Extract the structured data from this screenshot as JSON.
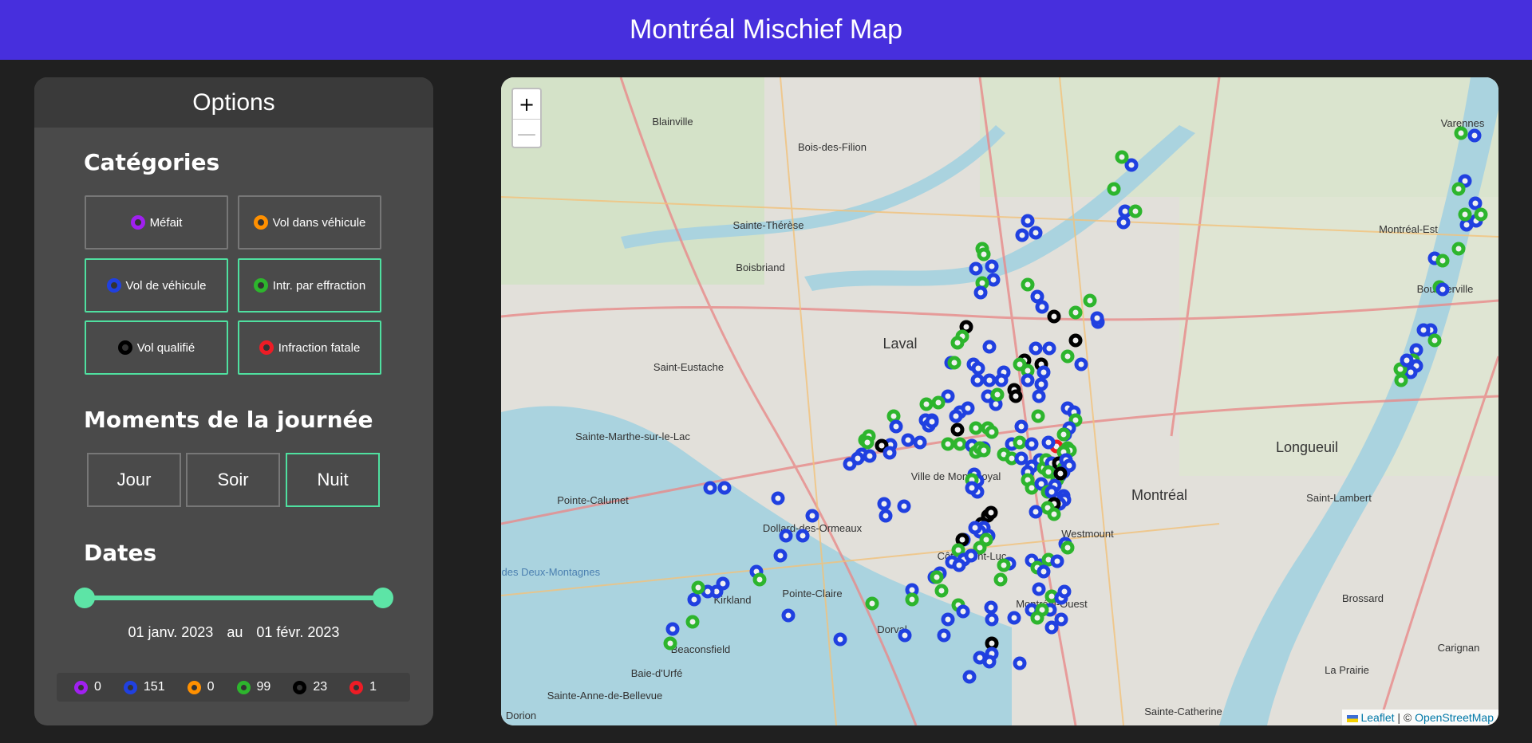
{
  "header": {
    "title": "Montréal Mischief Map"
  },
  "options": {
    "title": "Options",
    "categories_title": "Catégories",
    "categories": [
      {
        "label": "Méfait",
        "color": "#a020f0",
        "active": false
      },
      {
        "label": "Vol dans véhicule",
        "color": "#ff9000",
        "active": false
      },
      {
        "label": "Vol de véhicule",
        "color": "#2040e0",
        "active": true
      },
      {
        "label": "Intr. par effraction",
        "color": "#2db52d",
        "active": true
      },
      {
        "label": "Vol qualifié",
        "color": "#000000",
        "active": true
      },
      {
        "label": "Infraction fatale",
        "color": "#ee1c25",
        "active": true
      }
    ],
    "times_title": "Moments de la journée",
    "times": [
      {
        "label": "Jour",
        "active": false
      },
      {
        "label": "Soir",
        "active": false
      },
      {
        "label": "Nuit",
        "active": true
      }
    ],
    "dates_title": "Dates",
    "date_from": "01 janv. 2023",
    "date_sep": "au",
    "date_to": "01 févr. 2023",
    "counts": [
      {
        "color": "#a020f0",
        "value": "0"
      },
      {
        "color": "#2040e0",
        "value": "151"
      },
      {
        "color": "#ff9000",
        "value": "0"
      },
      {
        "color": "#2db52d",
        "value": "99"
      },
      {
        "color": "#000000",
        "value": "23"
      },
      {
        "color": "#ee1c25",
        "value": "1"
      }
    ]
  },
  "map": {
    "zoom_in": "+",
    "zoom_out": "—",
    "attribution_leaflet": "Leaflet",
    "attribution_sep": "| ©",
    "attribution_osm": "OpenStreetMap",
    "place_labels": [
      "Blainville",
      "Bois-des-Filion",
      "Sainte-Thérèse",
      "Boisbriand",
      "Laval",
      "Saint-Eustache",
      "Sainte-Marthe-sur-le-Lac",
      "Pointe-Calumet",
      "Dollard-des-Ormeaux",
      "Kirkland",
      "Pointe-Claire",
      "Dorval",
      "Beaconsfield",
      "Baie-d'Urfé",
      "Sainte-Anne-de-Bellevue",
      "Dorion",
      "Ville de Mont-Royal",
      "Côte-Saint-Luc",
      "Westmount",
      "Montréal-Ouest",
      "Montréal",
      "Montréal-Est",
      "Varennes",
      "Boucherville",
      "Longueuil",
      "Saint-Lambert",
      "Brossard",
      "La Prairie",
      "Sainte-Catherine",
      "Carignan",
      "Lac des Deux-Montagnes"
    ]
  }
}
